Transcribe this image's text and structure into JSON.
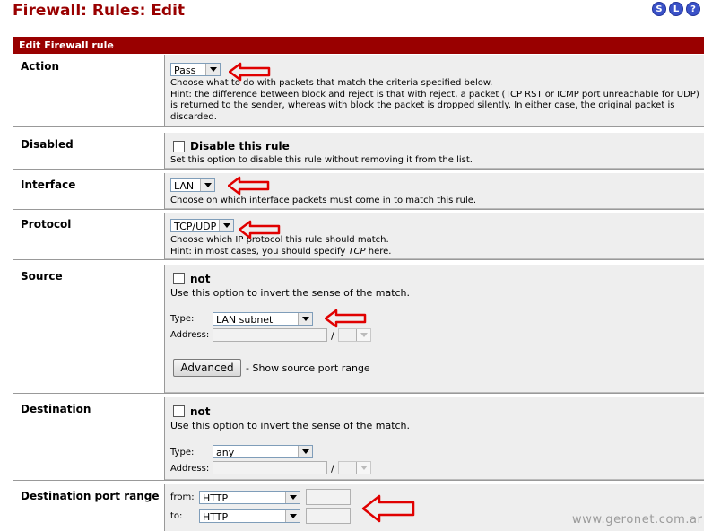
{
  "page": {
    "title": "Firewall: Rules: Edit",
    "top_icons": [
      {
        "name": "status-icon",
        "glyph": "S"
      },
      {
        "name": "log-icon",
        "glyph": "L"
      },
      {
        "name": "help-icon",
        "glyph": "?"
      }
    ],
    "section_header": "Edit Firewall rule"
  },
  "action": {
    "label": "Action",
    "value": "Pass",
    "hint1": "Choose what to do with packets that match the criteria specified below.",
    "hint2": "Hint: the difference between block and reject is that with reject, a packet (TCP RST or ICMP port unreachable for UDP)",
    "hint3": "is returned to the sender, whereas with block the packet is dropped silently. In either case, the original packet is",
    "hint4": "discarded."
  },
  "disabled": {
    "label": "Disabled",
    "checkbox_label": "Disable this rule",
    "hint": "Set this option to disable this rule without removing it from the list."
  },
  "interface": {
    "label": "Interface",
    "value": "LAN",
    "hint": "Choose on which interface packets must come in to match this rule."
  },
  "protocol": {
    "label": "Protocol",
    "value": "TCP/UDP",
    "hint1": "Choose which IP protocol this rule should match.",
    "hint2_prefix": "Hint: in most cases, you should specify",
    "hint2_em": "TCP",
    "hint2_suffix": "here."
  },
  "source": {
    "label": "Source",
    "not_label": "not",
    "invert_hint": "Use this option to invert the sense of the match.",
    "type_label": "Type:",
    "type_value": "LAN subnet",
    "address_label": "Address:",
    "slash": "/",
    "advanced_button": "Advanced",
    "advanced_hint": "- Show source port range"
  },
  "destination": {
    "label": "Destination",
    "not_label": "not",
    "invert_hint": "Use this option to invert the sense of the match.",
    "type_label": "Type:",
    "type_value": "any",
    "address_label": "Address:",
    "slash": "/"
  },
  "dest_port": {
    "label": "Destination port range",
    "from_label": "from:",
    "from_value": "HTTP",
    "to_label": "to:",
    "to_value": "HTTP"
  },
  "watermark": "www.geronet.com.ar",
  "colors": {
    "header_bg": "#990000",
    "title": "#990000",
    "content_bg": "#eeeeee",
    "annotation_arrow": "#e00000"
  }
}
